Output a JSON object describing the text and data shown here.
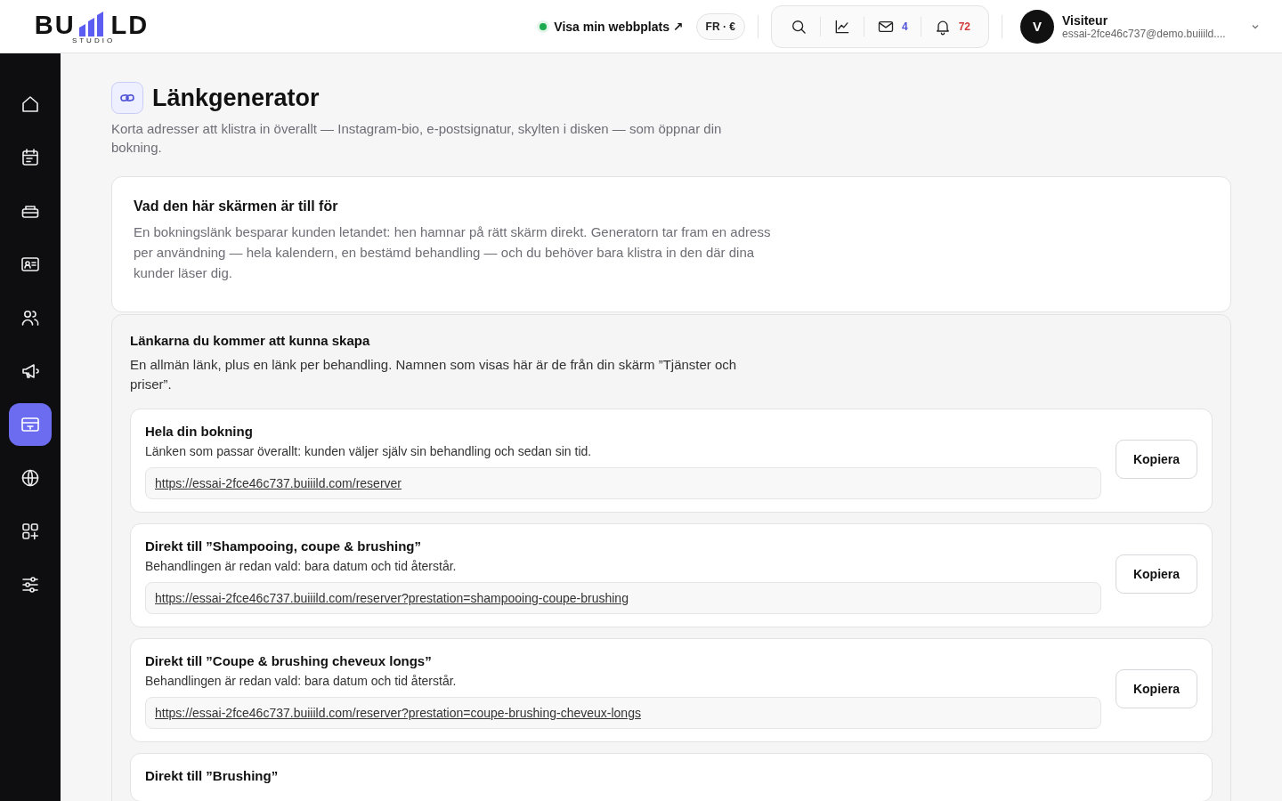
{
  "header": {
    "logo": {
      "left": "BU",
      "right": "LD",
      "sub": "STUDIO"
    },
    "site_link": {
      "label": "Visa min webbplats ↗",
      "online": true
    },
    "locale": {
      "language": "FR",
      "separator": "·",
      "currency": "€"
    },
    "toolbar": [
      {
        "kind": "search"
      },
      {
        "kind": "chart"
      },
      {
        "kind": "mail",
        "count": "4"
      },
      {
        "kind": "bell",
        "count": "72"
      }
    ],
    "user": {
      "initial": "V",
      "name": "Visiteur",
      "email": "essai-2fce46c737@demo.buiiild...."
    }
  },
  "sidebar": {
    "items": [
      {
        "kind": "home",
        "selected": false
      },
      {
        "kind": "calendar",
        "selected": false
      },
      {
        "kind": "toolbox",
        "selected": false
      },
      {
        "kind": "contact-card",
        "selected": false
      },
      {
        "kind": "people",
        "selected": false
      },
      {
        "kind": "megaphone",
        "selected": false
      },
      {
        "kind": "link-card",
        "selected": true
      },
      {
        "kind": "globe",
        "selected": false
      },
      {
        "kind": "apps",
        "selected": false
      },
      {
        "kind": "sliders",
        "selected": false
      }
    ]
  },
  "page": {
    "title": "Länkgenerator",
    "subtitle": "Korta adresser att klistra in överallt — Instagram-bio, e-postsignatur, skylten i disken — som öppnar din bokning."
  },
  "info_card": {
    "title": "Vad den här skärmen är till för",
    "text": "En bokningslänk besparar kunden letandet: hen hamnar på rätt skärm direkt. Generatorn tar fram en adress per användning — hela kalendern, en bestämd behandling — och du behöver bara klistra in den där dina kunder läser dig."
  },
  "links_section": {
    "title": "Länkarna du kommer att kunna skapa",
    "text": "En allmän länk, plus en länk per behandling. Namnen som visas här är de från din skärm ”Tjänster och priser”.",
    "links": [
      {
        "title": "Hela din bokning",
        "description": "Länken som passar överallt: kunden väljer själv sin behandling och sedan sin tid.",
        "url": "https://essai-2fce46c737.buiiild.com/reserver",
        "button": "Kopiera"
      },
      {
        "title": "Direkt till ”Shampooing, coupe & brushing”",
        "description": "Behandlingen är redan vald: bara datum och tid återstår.",
        "url": "https://essai-2fce46c737.buiiild.com/reserver?prestation=shampooing-coupe-brushing",
        "button": "Kopiera"
      },
      {
        "title": "Direkt till ”Coupe & brushing cheveux longs”",
        "description": "Behandlingen är redan vald: bara datum och tid återstår.",
        "url": "https://essai-2fce46c737.buiiild.com/reserver?prestation=coupe-brushing-cheveux-longs",
        "button": "Kopiera"
      },
      {
        "title": "Direkt till ”Brushing”"
      }
    ]
  }
}
